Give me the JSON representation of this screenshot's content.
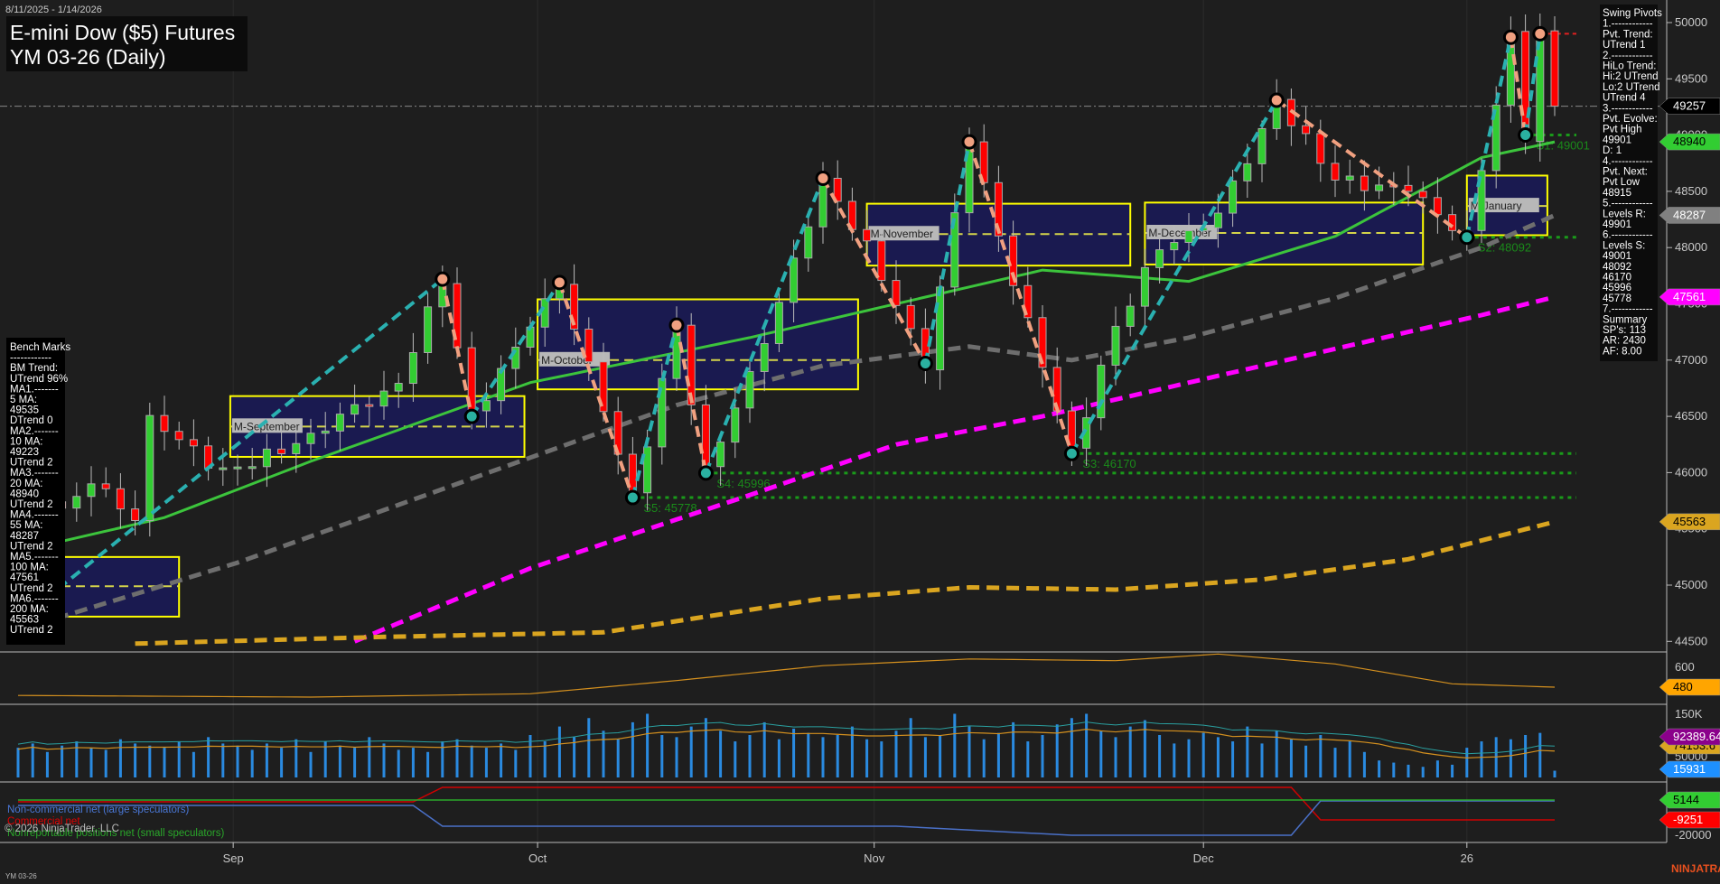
{
  "header": {
    "date_range": "8/11/2025 - 1/14/2026",
    "title_line1": "E-mini Dow ($5) Futures",
    "title_line2": "YM 03-26 (Daily)"
  },
  "footer": {
    "instrument": "YM 03-26",
    "brand": "NINJATRADER",
    "copyright": "© 2026 NinjaTrader, LLC"
  },
  "swing_pivots_panel": [
    "Swing Pivots",
    "1.------------",
    "Pvt. Trend:",
    "UTrend 1",
    "2.------------",
    "HiLo Trend:",
    "Hi:2 UTrend",
    "Lo:2 UTrend",
    "UTrend 4",
    "3.------------",
    "Pvt. Evolve:",
    "Pvt High",
    "49901",
    "D: 1",
    "4.------------",
    "Pvt. Next:",
    "Pvt Low",
    "48915",
    "5.------------",
    "Levels R:",
    "49901",
    "6.------------",
    "Levels S:",
    "49001",
    "48092",
    "46170",
    "45996",
    "45778",
    "7.------------",
    "Summary",
    "SP's: 113",
    "AR: 2430",
    "AF: 8.00"
  ],
  "bench_marks_panel": [
    "Bench Marks",
    "------------",
    "BM Trend:",
    "UTrend 96%",
    "MA1.-------",
    "5 MA:",
    "49535",
    "DTrend 0",
    "MA2.-------",
    "10 MA:",
    "49223",
    "UTrend 2",
    "MA3.-------",
    "20 MA:",
    "48940",
    "UTrend 2",
    "MA4.-------",
    "55 MA:",
    "48287",
    "UTrend 2",
    "MA5.-------",
    "100 MA:",
    "47561",
    "UTrend 2",
    "MA6.-------",
    "200 MA:",
    "45563",
    "UTrend 2"
  ],
  "cot_legend": {
    "noncommercial": "Non-commercial net (large speculators)",
    "commercial": "Commercial net",
    "nonreportable": "Nonreportable positions net (small speculators)"
  },
  "colors": {
    "up": "#32cd32",
    "down": "#ff0000",
    "ma20": "#3cc43c",
    "ma55": "#6e6e6e",
    "ma100": "#ff00ff",
    "ma200": "#daa520",
    "zig_up": "#2ab0b0",
    "zig_down": "#f0a080",
    "box": "#ffff00",
    "box_fill": "#1a1a50",
    "support": "#1a9a1a"
  },
  "chart_data": {
    "type": "candlestick",
    "title": "E-mini Dow ($5) Futures YM 03-26 (Daily)",
    "ylim": [
      44500,
      50000
    ],
    "y_ticks": [
      "50000",
      "49500",
      "49000",
      "48500",
      "48000",
      "47500",
      "47000",
      "46500",
      "46000",
      "45500",
      "45000",
      "44500"
    ],
    "x_ticks": [
      {
        "label": "Sep",
        "bar": 14.7
      },
      {
        "label": "Oct",
        "bar": 35.5
      },
      {
        "label": "Nov",
        "bar": 58.5
      },
      {
        "label": "Dec",
        "bar": 81
      },
      {
        "label": "26",
        "bar": 99
      }
    ],
    "bar_count": 106,
    "price_path_pivots": [
      [
        0,
        46100
      ],
      [
        3,
        45650
      ],
      [
        5,
        45900
      ],
      [
        8,
        45600
      ],
      [
        9,
        46450
      ],
      [
        12,
        46200
      ],
      [
        14,
        46000
      ],
      [
        18,
        46200
      ],
      [
        22,
        46500
      ],
      [
        26,
        46800
      ],
      [
        29,
        47720
      ],
      [
        31,
        46500
      ],
      [
        37,
        47690
      ],
      [
        42,
        45778
      ],
      [
        45,
        47310
      ],
      [
        47,
        45996
      ],
      [
        52,
        47500
      ],
      [
        55,
        48616
      ],
      [
        58,
        48000
      ],
      [
        62,
        46970
      ],
      [
        65,
        48940
      ],
      [
        68,
        47700
      ],
      [
        72,
        46170
      ],
      [
        75,
        47300
      ],
      [
        78,
        48000
      ],
      [
        82,
        48300
      ],
      [
        86,
        49310
      ],
      [
        90,
        48600
      ],
      [
        95,
        48500
      ],
      [
        99,
        48092
      ],
      [
        102,
        49870
      ],
      [
        103,
        49001
      ],
      [
        104,
        49901
      ],
      [
        105,
        49257
      ]
    ],
    "swing_zigzag": [
      [
        0,
        44680,
        "L"
      ],
      [
        29,
        47720,
        "H"
      ],
      [
        31,
        46500,
        "L"
      ],
      [
        37,
        47690,
        "H"
      ],
      [
        42,
        45778,
        "L"
      ],
      [
        45,
        47310,
        "H"
      ],
      [
        47,
        45996,
        "L"
      ],
      [
        55,
        48616,
        "H"
      ],
      [
        62,
        46970,
        "L"
      ],
      [
        65,
        48940,
        "H"
      ],
      [
        72,
        46170,
        "L"
      ],
      [
        86,
        49310,
        "H"
      ],
      [
        99,
        48092,
        "L"
      ],
      [
        102,
        49870,
        "H"
      ],
      [
        103,
        49001,
        "L"
      ],
      [
        104,
        49901,
        "H"
      ]
    ],
    "moving_averages": [
      {
        "name": "20 MA",
        "value": 48940,
        "points": [
          [
            0,
            45300
          ],
          [
            10,
            45600
          ],
          [
            20,
            46100
          ],
          [
            35,
            46800
          ],
          [
            50,
            47200
          ],
          [
            60,
            47500
          ],
          [
            70,
            47800
          ],
          [
            80,
            47700
          ],
          [
            90,
            48100
          ],
          [
            100,
            48800
          ],
          [
            105,
            48940
          ]
        ]
      },
      {
        "name": "55 MA",
        "value": 48287,
        "points": [
          [
            0,
            44600
          ],
          [
            15,
            45200
          ],
          [
            30,
            45900
          ],
          [
            45,
            46600
          ],
          [
            55,
            46950
          ],
          [
            65,
            47120
          ],
          [
            72,
            47000
          ],
          [
            80,
            47200
          ],
          [
            90,
            47550
          ],
          [
            100,
            48000
          ],
          [
            105,
            48287
          ]
        ]
      },
      {
        "name": "100 MA",
        "value": 47561,
        "points": [
          [
            23,
            44500
          ],
          [
            35,
            45150
          ],
          [
            50,
            45800
          ],
          [
            60,
            46250
          ],
          [
            70,
            46500
          ],
          [
            80,
            46800
          ],
          [
            90,
            47100
          ],
          [
            100,
            47400
          ],
          [
            105,
            47561
          ]
        ]
      },
      {
        "name": "200 MA",
        "value": 45563,
        "points": [
          [
            8,
            44480
          ],
          [
            25,
            44540
          ],
          [
            40,
            44580
          ],
          [
            55,
            44880
          ],
          [
            65,
            44980
          ],
          [
            75,
            44960
          ],
          [
            85,
            45050
          ],
          [
            95,
            45230
          ],
          [
            105,
            45563
          ]
        ]
      }
    ],
    "value_area_boxes": [
      {
        "label": "",
        "from": 0,
        "to": 11,
        "high": 45250,
        "low": 44720,
        "mid": 44990
      },
      {
        "label": "M-September",
        "from": 14.5,
        "to": 34.6,
        "high": 46680,
        "low": 46140,
        "mid": 46410
      },
      {
        "label": "M-October",
        "from": 35.5,
        "to": 57.4,
        "high": 47540,
        "low": 46740,
        "mid": 47000
      },
      {
        "label": "M-November",
        "from": 58,
        "to": 76,
        "high": 48390,
        "low": 47840,
        "mid": 48120
      },
      {
        "label": "M-December",
        "from": 77,
        "to": 96,
        "high": 48400,
        "low": 47850,
        "mid": 48130
      },
      {
        "label": "M-January",
        "from": 99,
        "to": 104.5,
        "high": 48640,
        "low": 48110,
        "mid": 48370
      }
    ],
    "support_levels": [
      {
        "label": "S1: 49001",
        "value": 49001,
        "from": 103
      },
      {
        "label": "S2: 48092",
        "value": 48092,
        "from": 99
      },
      {
        "label": "S3: 46170",
        "value": 46170,
        "from": 72
      },
      {
        "label": "S4: 45996",
        "value": 45996,
        "from": 47
      },
      {
        "label": "S5: 45778",
        "value": 45778,
        "from": 42
      }
    ],
    "resistance_level": {
      "value": 49901,
      "from": 104
    },
    "last_price": 49257,
    "price_tags": [
      {
        "value": "49257",
        "price": 49257,
        "bg": "#000000",
        "fg": "#ffffff"
      },
      {
        "value": "48940",
        "price": 48940,
        "bg": "#32cd32",
        "fg": "#000000"
      },
      {
        "value": "48287",
        "price": 48287,
        "bg": "#808080",
        "fg": "#ffffff"
      },
      {
        "value": "47561",
        "price": 47561,
        "bg": "#ff00ff",
        "fg": "#ffffff"
      },
      {
        "value": "45563",
        "price": 45563,
        "bg": "#daa520",
        "fg": "#000000"
      }
    ],
    "oscillator": {
      "ticks": [
        "600"
      ],
      "last": "480",
      "points": [
        [
          0,
          430
        ],
        [
          20,
          420
        ],
        [
          35,
          440
        ],
        [
          45,
          520
        ],
        [
          55,
          610
        ],
        [
          65,
          650
        ],
        [
          75,
          640
        ],
        [
          82,
          680
        ],
        [
          90,
          620
        ],
        [
          98,
          500
        ],
        [
          105,
          480
        ]
      ]
    },
    "volume": {
      "ticks": [
        "150K",
        "50000"
      ],
      "last": "15931",
      "line1_last": "92389.64",
      "line2_last": "74153.6",
      "values_k": [
        70,
        80,
        60,
        75,
        85,
        70,
        65,
        90,
        80,
        75,
        70,
        85,
        60,
        95,
        80,
        75,
        65,
        80,
        70,
        90,
        60,
        85,
        75,
        70,
        95,
        80,
        65,
        70,
        60,
        85,
        90,
        75,
        70,
        80,
        65,
        100,
        85,
        120,
        95,
        140,
        110,
        90,
        130,
        150,
        100,
        95,
        120,
        140,
        110,
        85,
        100,
        130,
        90,
        115,
        105,
        95,
        100,
        120,
        90,
        85,
        110,
        140,
        95,
        100,
        150,
        120,
        90,
        105,
        130,
        85,
        100,
        125,
        140,
        150,
        110,
        95,
        120,
        135,
        100,
        80,
        90,
        105,
        95,
        85,
        120,
        80,
        110,
        90,
        75,
        100,
        70,
        85,
        60,
        40,
        35,
        30,
        25,
        40,
        30,
        70,
        85,
        95,
        90,
        100,
        105,
        15.9
      ]
    },
    "cot": {
      "ticks": [
        "-20000"
      ],
      "noncommercial_last": "5144",
      "commercial_last": "-9251"
    }
  }
}
